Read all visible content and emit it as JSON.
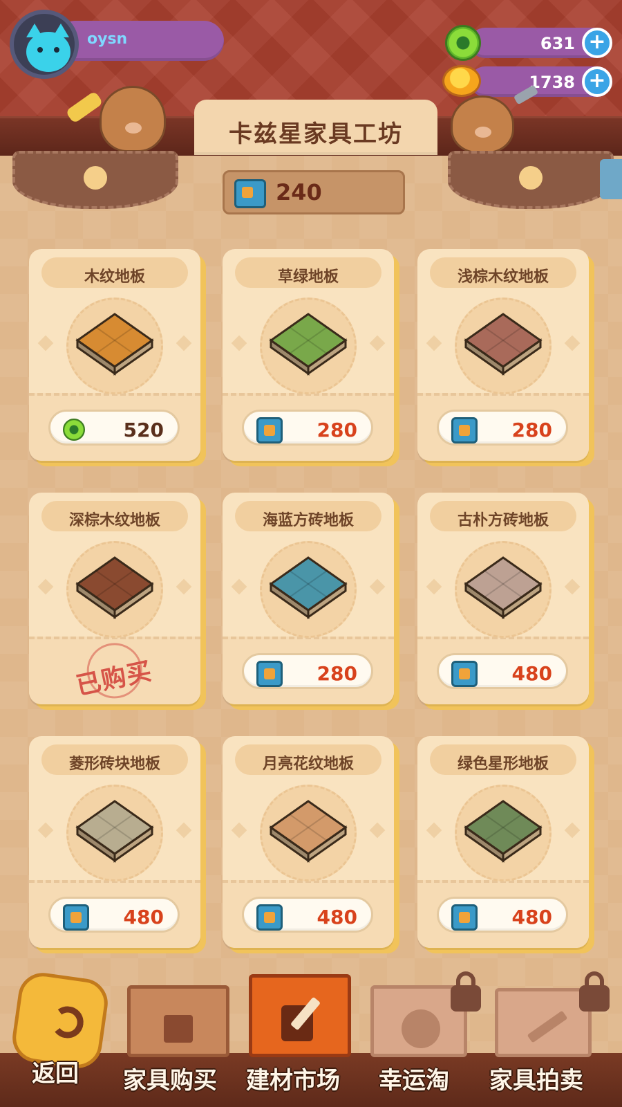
{
  "player": {
    "name": "oysn"
  },
  "currencies": {
    "green_coin": "631",
    "gold_planet": "1738",
    "plus": "+"
  },
  "header": {
    "title": "卡兹星家具工坊"
  },
  "ticket_balance": "240",
  "items": [
    {
      "name": "木纹地板",
      "price": "520",
      "currency": "green-coin",
      "purchased": false,
      "tile_color": "#d78b32"
    },
    {
      "name": "草绿地板",
      "price": "280",
      "currency": "ticket",
      "purchased": false,
      "tile_color": "#79a84a"
    },
    {
      "name": "浅棕木纹地板",
      "price": "280",
      "currency": "ticket",
      "purchased": false,
      "tile_color": "#a96a5a"
    },
    {
      "name": "深棕木纹地板",
      "price": "",
      "currency": "",
      "purchased": true,
      "stamp": "已购买",
      "tile_color": "#8a4a30"
    },
    {
      "name": "海蓝方砖地板",
      "price": "280",
      "currency": "ticket",
      "purchased": false,
      "tile_color": "#4a95a8"
    },
    {
      "name": "古朴方砖地板",
      "price": "480",
      "currency": "ticket",
      "purchased": false,
      "tile_color": "#bda193"
    },
    {
      "name": "菱形砖块地板",
      "price": "480",
      "currency": "ticket",
      "purchased": false,
      "tile_color": "#b8ad90"
    },
    {
      "name": "月亮花纹地板",
      "price": "480",
      "currency": "ticket",
      "purchased": false,
      "tile_color": "#d39a6a"
    },
    {
      "name": "绿色星形地板",
      "price": "480",
      "currency": "ticket",
      "purchased": false,
      "tile_color": "#6f8a58"
    }
  ],
  "nav": {
    "back": "返回",
    "tabs": [
      {
        "label": "家具购买",
        "active": false,
        "locked": false
      },
      {
        "label": "建材市场",
        "active": true,
        "locked": false
      },
      {
        "label": "幸运淘",
        "active": false,
        "locked": true
      },
      {
        "label": "家具拍卖",
        "active": false,
        "locked": true
      }
    ]
  }
}
